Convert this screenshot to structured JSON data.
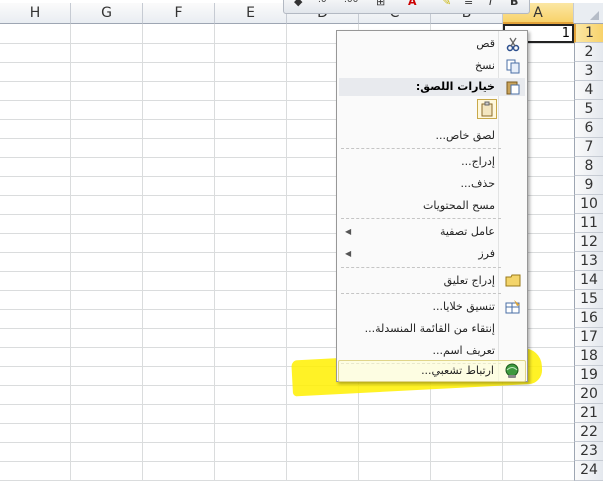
{
  "columns": [
    "H",
    "G",
    "F",
    "E",
    "D",
    "C",
    "B",
    "A"
  ],
  "rows": [
    "1",
    "2",
    "3",
    "4",
    "5",
    "6",
    "7",
    "8",
    "9",
    "10",
    "11",
    "12",
    "13",
    "14",
    "15",
    "16",
    "17",
    "18",
    "19",
    "20",
    "21",
    "22",
    "23",
    "24"
  ],
  "cell_a1": "1",
  "mini_toolbar": {
    "bold": "B",
    "italic": "I",
    "font_color": "A"
  },
  "menu": {
    "cut": "قص",
    "copy": "نسخ",
    "paste_options": "خيارات اللصق:",
    "paste_special": "لصق خاص...",
    "insert": "إدراج...",
    "delete": "حذف...",
    "clear_contents": "مسح المحتويات",
    "filter": "عامل تصفية",
    "sort": "فرز",
    "insert_comment": "إدراج تعليق",
    "format_cells": "تنسيق خلايا...",
    "pick_from_list": "إنتقاء من القائمة المنسدلة...",
    "define_name": "تعريف اسم...",
    "hyperlink": "ارتباط تشعبي..."
  },
  "colors": {
    "highlight": "#fff000",
    "selected_header": "#f8d26a"
  }
}
